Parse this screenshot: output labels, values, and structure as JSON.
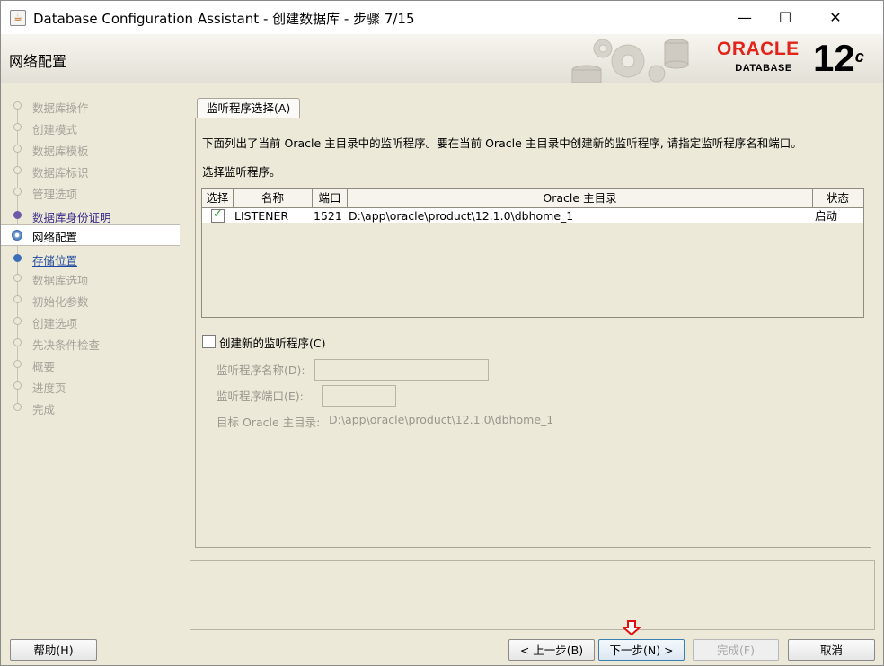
{
  "window": {
    "title": "Database Configuration Assistant - 创建数据库 - 步骤 7/15",
    "controls": {
      "minimize": "—",
      "maximize": "☐",
      "close": "✕"
    }
  },
  "header": {
    "step_title": "网络配置",
    "logo": {
      "brand": "ORACLE",
      "product": "DATABASE",
      "version": "12",
      "version_suffix": "c"
    }
  },
  "sidebar": {
    "items": [
      {
        "label": "数据库操作",
        "state": "done"
      },
      {
        "label": "创建模式",
        "state": "done"
      },
      {
        "label": "数据库模板",
        "state": "done"
      },
      {
        "label": "数据库标识",
        "state": "done"
      },
      {
        "label": "管理选项",
        "state": "done"
      },
      {
        "label": "数据库身份证明",
        "state": "link"
      },
      {
        "label": "网络配置",
        "state": "active"
      },
      {
        "label": "存储位置",
        "state": "next"
      },
      {
        "label": "数据库选项",
        "state": "pending"
      },
      {
        "label": "初始化参数",
        "state": "pending"
      },
      {
        "label": "创建选项",
        "state": "pending"
      },
      {
        "label": "先决条件检查",
        "state": "pending"
      },
      {
        "label": "概要",
        "state": "pending"
      },
      {
        "label": "进度页",
        "state": "pending"
      },
      {
        "label": "完成",
        "state": "pending"
      }
    ]
  },
  "main": {
    "tab_label": "监听程序选择(A)",
    "description": "下面列出了当前 Oracle 主目录中的监听程序。要在当前 Oracle 主目录中创建新的监听程序, 请指定监听程序名和端口。",
    "select_label": "选择监听程序。",
    "table": {
      "headers": [
        "选择",
        "名称",
        "端口",
        "Oracle 主目录",
        "状态"
      ],
      "rows": [
        {
          "selected": true,
          "name": "LISTENER",
          "port": "1521",
          "home": "D:\\app\\oracle\\product\\12.1.0\\dbhome_1",
          "status": "启动"
        }
      ]
    },
    "create_new": {
      "checkbox_label": "创建新的监听程序(C)",
      "checked": false,
      "name_label": "监听程序名称(D):",
      "name_value": "",
      "port_label": "监听程序端口(E):",
      "port_value": "",
      "target_label": "目标 Oracle 主目录:",
      "target_value": "D:\\app\\oracle\\product\\12.1.0\\dbhome_1"
    }
  },
  "footer": {
    "help": "帮助(H)",
    "back": "< 上一步(B)",
    "next": "下一步(N) >",
    "finish": "完成(F)",
    "cancel": "取消"
  },
  "colors": {
    "accent_red": "#e2231a",
    "link": "#3a2a8c",
    "panel_bg": "#ece9d8"
  }
}
